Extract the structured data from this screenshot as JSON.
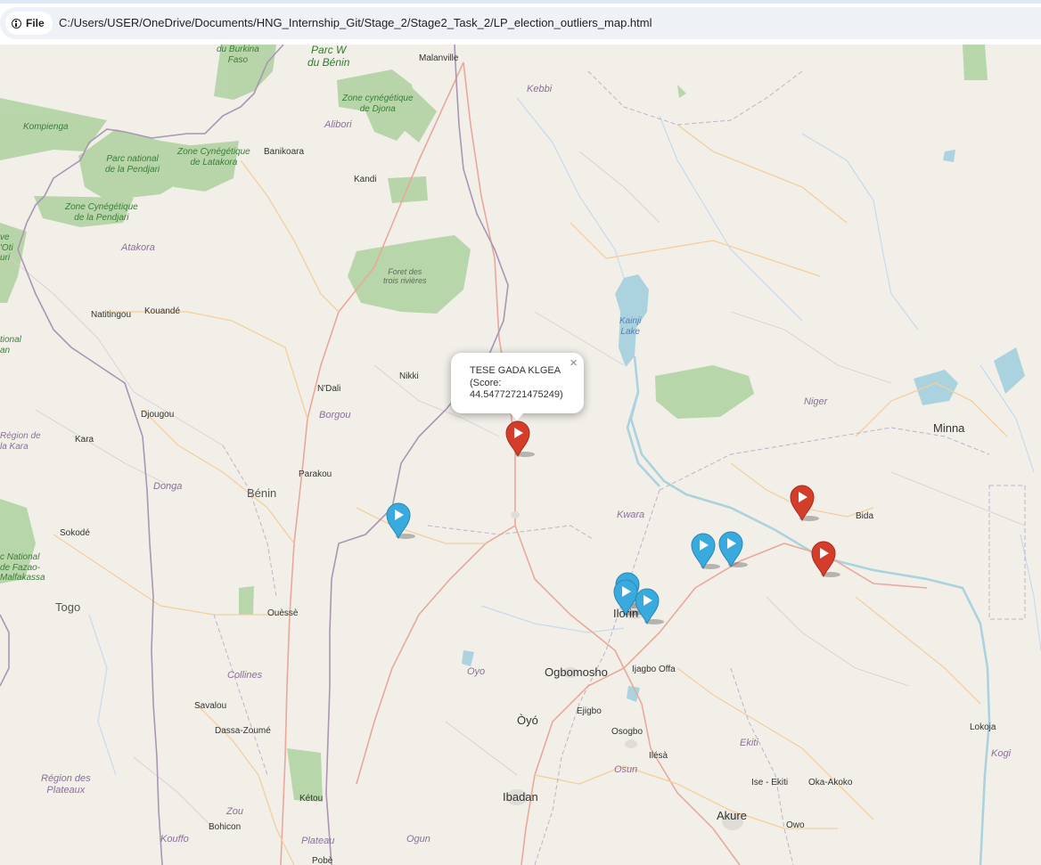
{
  "browser": {
    "file_chip_label": "File",
    "url": "C:/Users/USER/OneDrive/Documents/HNG_Internship_Git/Stage_2/Stage2_Task_2/LP_election_outliers_map.html"
  },
  "popup": {
    "line1": "TESE GADA KLGEA",
    "line2": "(Score:",
    "line3": "44.54772721475249)",
    "close_glyph": "×"
  },
  "colors": {
    "red_marker": "#d33d29",
    "blue_marker": "#38aadd",
    "park_green": "#add19e",
    "water_blue": "#aad3df"
  },
  "marker_icon": "play-icon",
  "labels": {
    "burkina": "du Burkina\nFaso",
    "parcw": "Parc W\ndu Bénin",
    "malanville": "Malanville",
    "kebbi": "Kebbi",
    "djona": "Zone cynégétique\nde Djona",
    "alibori": "Alibori",
    "kompienga": "Kompienga",
    "pendjari_park": "Parc national\nde la Pendjari",
    "latakora": "Zone Cynégétique\nde Latakora",
    "banikoara": "Banikoara",
    "kandi": "Kandi",
    "pendjari_zone": "Zone Cynégétique\nde la Pendjari",
    "atakora": "Atakora",
    "oti": "ve\n'Oti\nuri",
    "trois": "Foret des\ntrois rivières",
    "kainji": "Kainji\nLake",
    "natitingou": "Natitingou",
    "kouande": "Kouandé",
    "national_left": "tional\nan",
    "nikki": "Nikki",
    "ndali": "N'Dali",
    "borgou": "Borgou",
    "djougou": "Djougou",
    "niger": "Niger",
    "minna": "Minna",
    "region_kara": "Région de\nla Kara",
    "kara": "Kara",
    "parakou": "Parakou",
    "donga": "Donga",
    "benin": "Bénin",
    "kwara": "Kwara",
    "bida": "Bida",
    "sokode": "Sokodé",
    "fazao": "c National\nde Fazao-\nMalfakassa",
    "togo": "Togo",
    "ilorin": "Ilorin",
    "ouesse": "Ouèssè",
    "oyo_region": "Oyo",
    "ogbomosho": "Ogbomosho",
    "ijagbo": "Ijagbo Offa",
    "collines": "Collines",
    "savalou": "Savalou",
    "ejigbo": "Ejigbo",
    "oyo_town": "Òyó",
    "osogbo": "Osogbo",
    "dassa": "Dassa-Zoumé",
    "ekiti": "Ekiti",
    "lokoja": "Lokoja",
    "ilesa": "Ilésà",
    "kogi": "Kogi",
    "osun": "Osun",
    "plateaux": "Région des\nPlateaux",
    "ise": "Ise - Ekiti",
    "oka": "Oka-Akoko",
    "ketou": "Kétou",
    "ibadan": "Ibadan",
    "zou": "Zou",
    "akure": "Akure",
    "bohicon": "Bohicon",
    "owo": "Owo",
    "kouffo": "Kouffo",
    "plateau": "Plateau",
    "ogun": "Ogun",
    "pobe": "Pobè"
  }
}
